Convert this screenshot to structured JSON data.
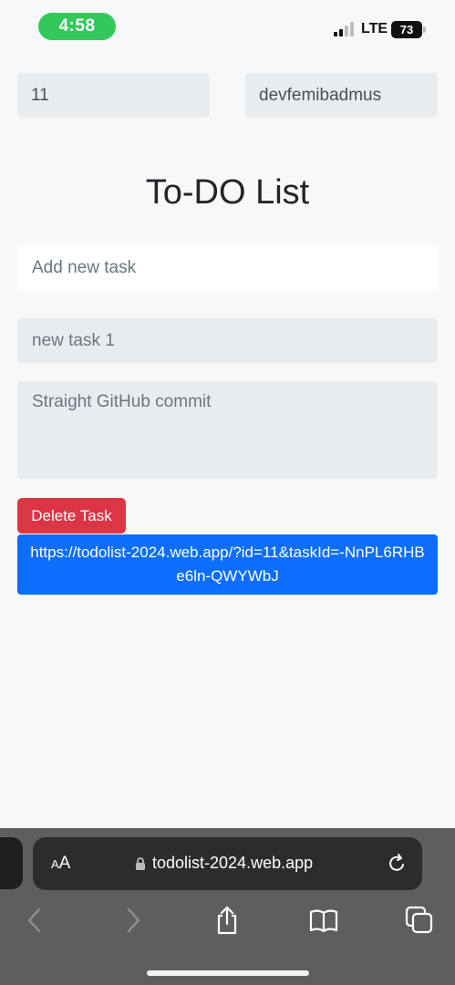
{
  "status_bar": {
    "time": "4:58",
    "network": "LTE",
    "battery": "73"
  },
  "fields": {
    "list_id": "11",
    "username": "devfemibadmus"
  },
  "title": "To-DO List",
  "add_task": {
    "placeholder": "Add new task"
  },
  "task": {
    "name": "new task 1",
    "description": "Straight GitHub commit"
  },
  "delete_button": "Delete Task",
  "share_link": "https://todolist-2024.web.app/?id=11&taskId=-NnPL6RHBe6ln-QWYWbJ",
  "browser": {
    "aa_label_small": "A",
    "aa_label_large": "A",
    "url": "todolist-2024.web.app"
  },
  "colors": {
    "accent_blue": "#0d6efd",
    "danger_red": "#dc3545",
    "time_pill_green": "#34c759"
  }
}
